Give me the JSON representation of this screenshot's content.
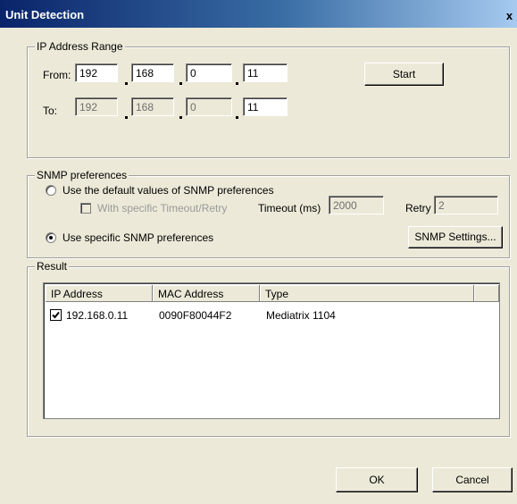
{
  "window": {
    "title": "Unit Detection",
    "close_symbol": "x"
  },
  "ip_range": {
    "legend": "IP Address Range",
    "from_label": "From:",
    "to_label": "To:",
    "from": [
      "192",
      "168",
      "0",
      "11"
    ],
    "to": [
      "192",
      "168",
      "0",
      "11"
    ],
    "start_label": "Start"
  },
  "snmp": {
    "legend": "SNMP preferences",
    "option_default": "Use the default values of SNMP preferences",
    "option_specific": "Use specific SNMP preferences",
    "selected": "specific",
    "specific_timeout_retry": "With specific Timeout/Retry",
    "timeout_label": "Timeout (ms)",
    "timeout_value": "2000",
    "retry_label": "Retry",
    "retry_value": "2",
    "settings_label": "SNMP Settings..."
  },
  "result": {
    "legend": "Result",
    "columns": [
      "IP Address",
      "MAC Address",
      "Type"
    ],
    "rows": [
      {
        "checked": true,
        "ip": "192.168.0.11",
        "mac": "0090F80044F2",
        "type": "Mediatrix 1104"
      }
    ]
  },
  "buttons": {
    "ok": "OK",
    "cancel": "Cancel"
  }
}
